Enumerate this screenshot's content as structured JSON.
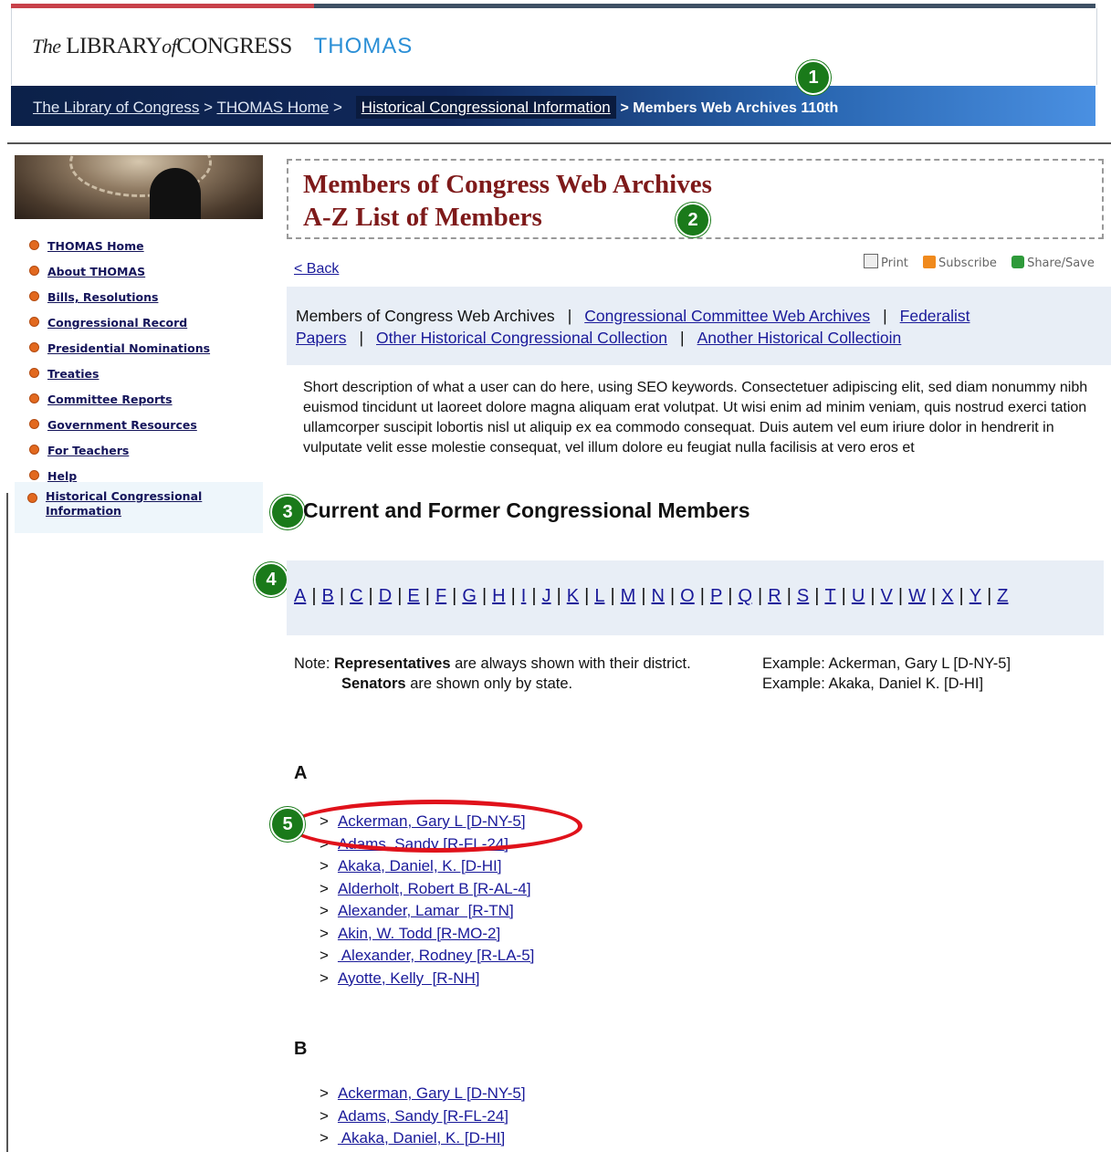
{
  "header": {
    "logo_the": "The",
    "logo_library": "LIBRARY",
    "logo_of": "of",
    "logo_congress": "CONGRESS",
    "logo_thomas": "THOMAS"
  },
  "breadcrumb": {
    "lib": "The Library of Congress",
    "sep1": ">",
    "home": "THOMAS Home",
    "sep2": ">",
    "hist": "Historical Congressional Information",
    "current": "> Members Web Archives 110th"
  },
  "badges": [
    "1",
    "2",
    "3",
    "4",
    "5"
  ],
  "sidebar": {
    "items": [
      "THOMAS Home",
      "About THOMAS",
      "Bills, Resolutions",
      "Congressional Record",
      "Presidential Nominations",
      "Treaties",
      "Committee Reports",
      "Government Resources",
      "For Teachers",
      "Help"
    ],
    "active": "Historical Congressional Information"
  },
  "title": {
    "line1": "Members of Congress Web Archives",
    "line2": "A-Z List of Members"
  },
  "back_link": "< Back",
  "tools": {
    "print": "Print",
    "subscribe": "Subscribe",
    "share": "Share/Save"
  },
  "tabs": {
    "current": "Members of Congress Web Archives",
    "committee": "Congressional Committee Web Archives",
    "federalist1": "Federalist",
    "federalist2": "Papers",
    "other": "Other Historical Congressional Collection",
    "another": "Another Historical Collectioin",
    "sep": "|"
  },
  "description": "Short description of what a user can do here, using SEO keywords.  Consectetuer adipiscing elit, sed diam nonummy nibh euismod tincidunt ut laoreet dolore magna aliquam erat volutpat. Ut wisi enim ad minim veniam, quis nostrud exerci tation ullamcorper suscipit lobortis nisl ut aliquip ex ea commodo consequat. Duis autem vel eum iriure dolor in hendrerit in vulputate velit esse molestie consequat, vel illum dolore eu feugiat nulla facilisis at vero eros et",
  "section_title": "Current and Former Congressional Members",
  "alphabet": [
    "A",
    "B",
    "C",
    "D",
    "E",
    "F",
    "G",
    "H",
    "I",
    "J",
    "K",
    "L",
    "M",
    "N",
    "O",
    "P",
    "Q",
    "R",
    "S",
    "T",
    "U",
    "V",
    "W",
    "X",
    "Y",
    "Z"
  ],
  "note": {
    "prefix": "Note:",
    "rep_bold": "Representatives",
    "rep_rest": " are always shown with their district.",
    "sen_bold": "Senators",
    "sen_rest": " are shown only by state.",
    "example1": "Example: Ackerman, Gary L [D-NY-5]",
    "example2": "Example: Akaka, Daniel K. [D-HI]"
  },
  "groups": [
    {
      "letter": "A",
      "members": [
        "Ackerman, Gary L [D-NY-5]",
        "Adams, Sandy [R-FL-24]",
        "Akaka, Daniel, K. [D-HI]",
        "Alderholt, Robert B [R-AL-4]",
        "Alexander, Lamar  [R-TN]",
        "Akin, W. Todd [R-MO-2]",
        " Alexander, Rodney [R-LA-5]",
        "Ayotte, Kelly  [R-NH]"
      ]
    },
    {
      "letter": "B",
      "members": [
        "Ackerman, Gary L [D-NY-5]",
        "Adams, Sandy [R-FL-24]",
        " Akaka, Daniel, K. [D-HI]"
      ]
    }
  ],
  "list_marker": ">",
  "colors": {
    "title": "#7e1a1a",
    "link": "#1a1a9a",
    "badge": "#1a7a1a",
    "highlight_oval": "#e0121b",
    "band": "#e8eef6",
    "crumb_bar": "#10275a"
  }
}
